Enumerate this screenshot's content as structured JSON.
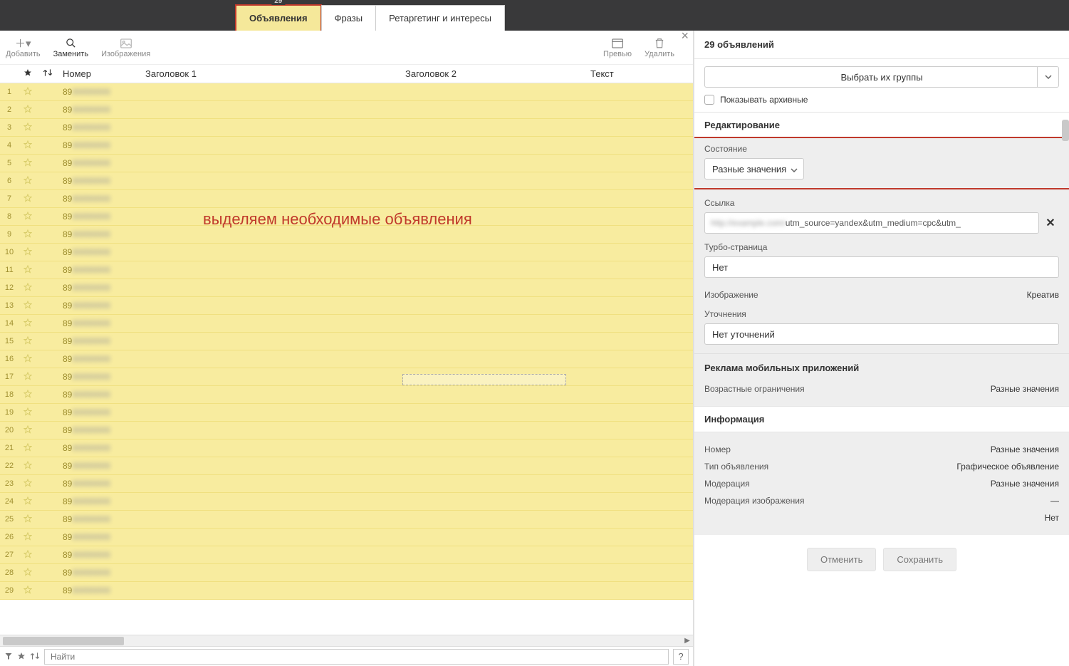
{
  "tabs": {
    "badge": "29",
    "items": [
      "Объявления",
      "Фразы",
      "Ретаргетинг и интересы"
    ]
  },
  "toolbar": {
    "add": "Добавить",
    "replace": "Заменить",
    "images": "Изображения",
    "preview": "Превью",
    "delete": "Удалить"
  },
  "columns": {
    "number": "Номер",
    "heading1": "Заголовок 1",
    "heading2": "Заголовок 2",
    "text": "Текст"
  },
  "annotation": "выделяем необходимые объявления",
  "rows_prefix": "89",
  "row_count": 29,
  "search": {
    "placeholder": "Найти",
    "help": "?"
  },
  "right": {
    "title": "29 объявлений",
    "select_groups": "Выбрать их группы",
    "show_archived": "Показывать архивные",
    "editing": "Редактирование",
    "state": {
      "label": "Состояние",
      "value": "Разные значения"
    },
    "link": {
      "label": "Ссылка",
      "value": "utm_source=yandex&utm_medium=cpc&utm_"
    },
    "turbo": {
      "label": "Турбо-страница",
      "value": "Нет"
    },
    "image": {
      "label": "Изображение",
      "value": "Креатив"
    },
    "clarif": {
      "label": "Уточнения",
      "value": "Нет уточнений"
    },
    "mobile": {
      "title": "Реклама мобильных приложений",
      "age_label": "Возрастные ограничения",
      "age_value": "Разные значения"
    },
    "info": {
      "title": "Информация",
      "number": {
        "k": "Номер",
        "v": "Разные значения"
      },
      "type": {
        "k": "Тип объявления",
        "v": "Графическое объявление"
      },
      "moder": {
        "k": "Модерация",
        "v": "Разные значения"
      },
      "moder_img": {
        "k": "Модерация изображения",
        "v": "—"
      },
      "extra": {
        "k": "",
        "v": "Нет"
      }
    },
    "cancel": "Отменить",
    "save": "Сохранить"
  }
}
